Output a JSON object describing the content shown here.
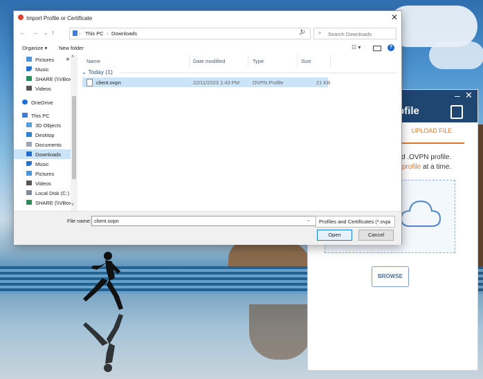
{
  "dialog": {
    "title": "Import Profile or Certificate",
    "close": "✕",
    "breadcrumb": [
      "This PC",
      "Downloads"
    ],
    "search_placeholder": "Search Downloads",
    "toolbar": {
      "organize": "Organize ▾",
      "new_folder": "New folder",
      "help": "?"
    },
    "nav_items": [
      {
        "label": "Pictures",
        "icon": "pictures-icon"
      },
      {
        "label": "Music",
        "icon": "music-icon"
      },
      {
        "label": "SHARE (\\\\VBoxS",
        "icon": "network-drive-icon"
      },
      {
        "label": "Videos",
        "icon": "videos-icon"
      },
      {
        "label": "OneDrive",
        "icon": "onedrive-icon"
      },
      {
        "label": "This PC",
        "icon": "this-pc-icon"
      },
      {
        "label": "3D Objects",
        "icon": "3d-objects-icon"
      },
      {
        "label": "Desktop",
        "icon": "desktop-icon"
      },
      {
        "label": "Documents",
        "icon": "documents-icon"
      },
      {
        "label": "Downloads",
        "icon": "downloads-icon"
      },
      {
        "label": "Music",
        "icon": "music-icon"
      },
      {
        "label": "Pictures",
        "icon": "pictures-icon"
      },
      {
        "label": "Videos",
        "icon": "videos-icon"
      },
      {
        "label": "Local Disk (C:)",
        "icon": "local-disk-icon"
      },
      {
        "label": "SHARE (\\\\VBoxS",
        "icon": "network-drive-icon"
      }
    ],
    "columns": {
      "name": "Name",
      "date_modified": "Date modified",
      "type": "Type",
      "size": "Size"
    },
    "group": "Today (1)",
    "files": [
      {
        "name": "client.ovpn",
        "date_modified": "22/11/2023 1:43 PM",
        "type": "OVPN Profile",
        "size": "21 KB"
      }
    ],
    "file_name_label": "File name:",
    "file_name_value": "client.ovpn",
    "file_type": "Profiles and Certificates (*.ovpr",
    "open_label": "Open",
    "cancel_label": "Cancel"
  },
  "vpn_window": {
    "title_fragment": "ofile",
    "minimize": "–",
    "close": "✕",
    "tab": "UPLOAD FILE",
    "text_line1": "d .OVPN profile.",
    "text_line2_highlight": "profile",
    "text_line2_rest": "at a time.",
    "browse_label": "BROWSE",
    "accent_color": "#e0772b"
  }
}
